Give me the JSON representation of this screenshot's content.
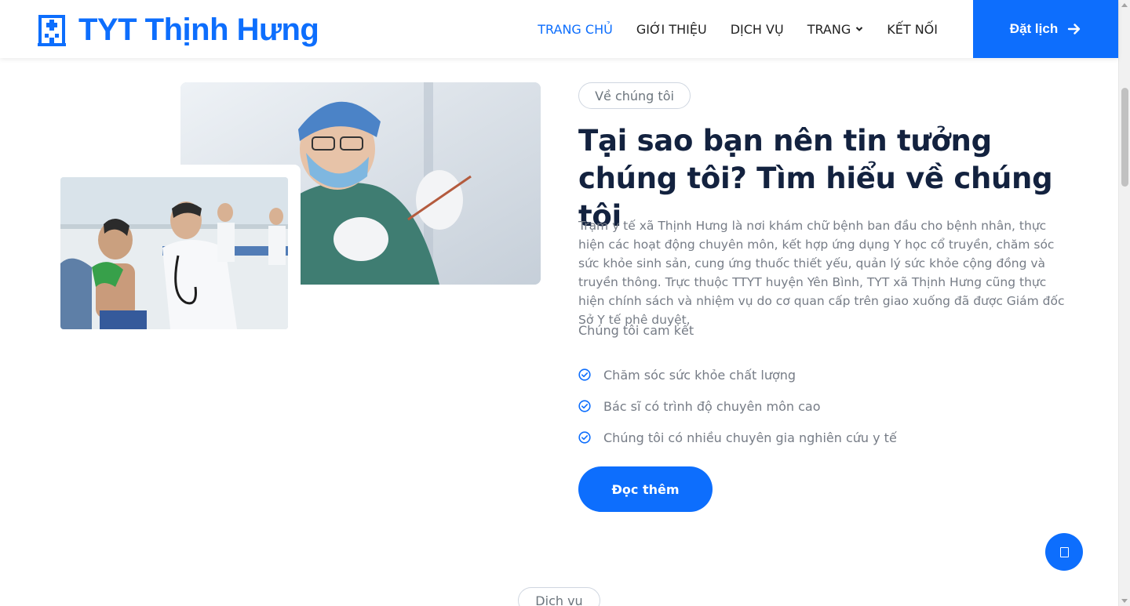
{
  "brand": {
    "name": "TYT Thịnh Hưng",
    "icon": "hospital-icon"
  },
  "nav": {
    "items": [
      {
        "label": "TRANG CHỦ",
        "active": true
      },
      {
        "label": "GIỚI THIỆU",
        "active": false
      },
      {
        "label": "DỊCH VỤ",
        "active": false
      },
      {
        "label": "TRANG",
        "active": false,
        "dropdown": true
      },
      {
        "label": "KẾT NỐI",
        "active": false
      }
    ],
    "cta_label": "Đặt lịch",
    "cta_icon": "arrow-right-icon"
  },
  "about": {
    "tag": "Về chúng tôi",
    "heading": "Tại sao bạn nên tin tưởng chúng tôi? Tìm hiểu về chúng tôi",
    "paragraph": "Trạm y tế xã Thịnh Hưng là nơi khám chữ bệnh ban đầu cho bệnh nhân, thực hiện các hoạt động chuyên môn, kết hợp ứng dụng Y học cổ truyền, chăm sóc sức khỏe sinh sản, cung ứng thuốc thiết yếu, quản lý sức khỏe cộng đồng và truyền thông. Trực thuộc TTYT huyện Yên Bình, TYT xã Thịnh Hưng cũng thực hiện chính sách và nhiệm vụ do cơ quan cấp trên giao xuống đã được Giám đốc Sở Y tế phê duyệt.",
    "commit_label": "Chúng tôi cam kết",
    "commitments": [
      "Chăm sóc sức khỏe chất lượng",
      "Bác sĩ có trình độ chuyên môn cao",
      "Chúng tôi có nhiều chuyên gia nghiên cứu y tế"
    ],
    "read_more": "Đọc thêm"
  },
  "next_section": {
    "tag": "Dịch vụ"
  },
  "colors": {
    "primary": "#0d6efd",
    "heading": "#13223f",
    "text": "#767c86"
  }
}
